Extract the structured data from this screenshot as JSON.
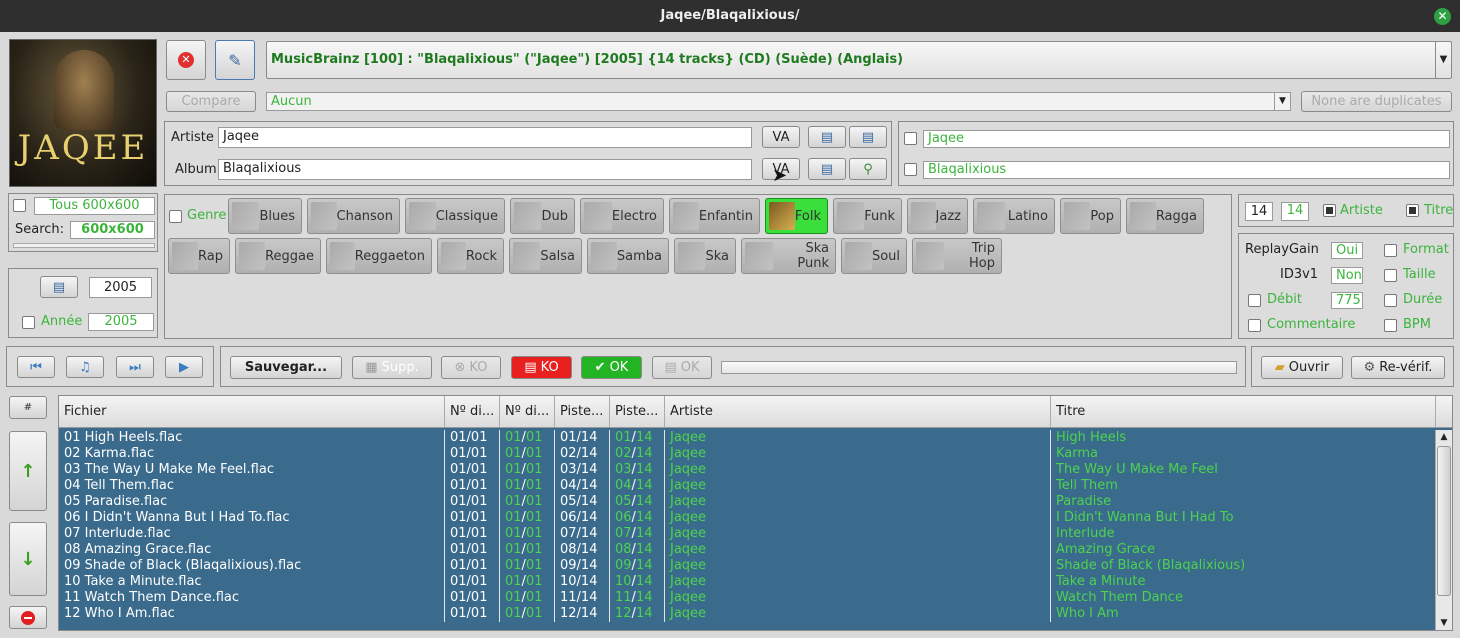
{
  "window": {
    "title": "Jaqee/Blaqalixious/"
  },
  "cover": {
    "artist_text": "JAQEE"
  },
  "cover_panel": {
    "label": "Tous 600x600",
    "search_label": "Search:",
    "search_value": "600x600"
  },
  "year_panel": {
    "year": "2005",
    "annee_label": "Année",
    "annee_value": "2005"
  },
  "musicbrainz": {
    "result": "MusicBrainz [100] : \"Blaqalixious\" (\"Jaqee\") [2005] {14 tracks} (CD) (Suède) (Anglais)"
  },
  "compare": {
    "label": "Compare",
    "select_value": "Aucun",
    "duplicates_label": "None are duplicates"
  },
  "tags": {
    "artiste_label": "Artiste",
    "artiste_value": "Jaqee",
    "album_label": "Album",
    "album_value": "Blaqalixious",
    "va_label": "VA"
  },
  "right_tags": {
    "artist": "Jaqee",
    "album": "Blaqalixious"
  },
  "genre": {
    "label": "Genre",
    "items": [
      "Blues",
      "Chanson",
      "Classique",
      "Dub",
      "Electro",
      "Enfantin",
      "Folk",
      "Funk",
      "Jazz",
      "Latino",
      "Pop",
      "Ragga",
      "Rap",
      "Reggae",
      "Reggaeton",
      "Rock",
      "Salsa",
      "Samba",
      "Ska",
      "Ska Punk",
      "Soul",
      "Trip Hop"
    ],
    "active": "Folk"
  },
  "track_counts": {
    "total": "14",
    "total_green": "14",
    "artiste_label": "Artiste",
    "titre_label": "Titre"
  },
  "options": {
    "replaygain_label": "ReplayGain",
    "replaygain_value": "Oui",
    "id3_label": "ID3v1",
    "id3_value": "Non",
    "debit_label": "Débit",
    "debit_value": "775",
    "commentaire_label": "Commentaire",
    "format_label": "Format",
    "taille_label": "Taille",
    "duree_label": "Durée",
    "bpm_label": "BPM"
  },
  "actions": {
    "save_label": "Sauvegar...",
    "delete_label": "Supp.",
    "ko1_label": "KO",
    "ko2_label": "KO",
    "ok1_label": "OK",
    "ok2_label": "OK",
    "open_label": "Ouvrir",
    "recheck_label": "Re-vérif."
  },
  "table": {
    "columns": [
      "Fichier",
      "Nº di...",
      "Nº di...",
      "Piste...",
      "Piste...",
      "Artiste",
      "Titre"
    ],
    "rows": [
      {
        "file": "01 High Heels.flac",
        "d1": "01/01",
        "d2a": "01",
        "d2b": "01",
        "p1": "01/14",
        "p2a": "01",
        "p2b": "14",
        "artist": "Jaqee",
        "title": "High Heels"
      },
      {
        "file": "02 Karma.flac",
        "d1": "01/01",
        "d2a": "01",
        "d2b": "01",
        "p1": "02/14",
        "p2a": "02",
        "p2b": "14",
        "artist": "Jaqee",
        "title": "Karma"
      },
      {
        "file": "03 The Way U Make Me Feel.flac",
        "d1": "01/01",
        "d2a": "01",
        "d2b": "01",
        "p1": "03/14",
        "p2a": "03",
        "p2b": "14",
        "artist": "Jaqee",
        "title": "The Way U Make Me Feel"
      },
      {
        "file": "04 Tell Them.flac",
        "d1": "01/01",
        "d2a": "01",
        "d2b": "01",
        "p1": "04/14",
        "p2a": "04",
        "p2b": "14",
        "artist": "Jaqee",
        "title": "Tell Them"
      },
      {
        "file": "05 Paradise.flac",
        "d1": "01/01",
        "d2a": "01",
        "d2b": "01",
        "p1": "05/14",
        "p2a": "05",
        "p2b": "14",
        "artist": "Jaqee",
        "title": "Paradise"
      },
      {
        "file": "06 I Didn't Wanna But I Had To.flac",
        "d1": "01/01",
        "d2a": "01",
        "d2b": "01",
        "p1": "06/14",
        "p2a": "06",
        "p2b": "14",
        "artist": "Jaqee",
        "title": "I Didn't Wanna But I Had To"
      },
      {
        "file": "07 Interlude.flac",
        "d1": "01/01",
        "d2a": "01",
        "d2b": "01",
        "p1": "07/14",
        "p2a": "07",
        "p2b": "14",
        "artist": "Jaqee",
        "title": "Interlude"
      },
      {
        "file": "08 Amazing Grace.flac",
        "d1": "01/01",
        "d2a": "01",
        "d2b": "01",
        "p1": "08/14",
        "p2a": "08",
        "p2b": "14",
        "artist": "Jaqee",
        "title": "Amazing Grace"
      },
      {
        "file": "09 Shade of Black (Blaqalixious).flac",
        "d1": "01/01",
        "d2a": "01",
        "d2b": "01",
        "p1": "09/14",
        "p2a": "09",
        "p2b": "14",
        "artist": "Jaqee",
        "title": "Shade of Black (Blaqalixious)"
      },
      {
        "file": "10 Take a Minute.flac",
        "d1": "01/01",
        "d2a": "01",
        "d2b": "01",
        "p1": "10/14",
        "p2a": "10",
        "p2b": "14",
        "artist": "Jaqee",
        "title": "Take a Minute"
      },
      {
        "file": "11 Watch Them Dance.flac",
        "d1": "01/01",
        "d2a": "01",
        "d2b": "01",
        "p1": "11/14",
        "p2a": "11",
        "p2b": "14",
        "artist": "Jaqee",
        "title": "Watch Them Dance"
      },
      {
        "file": "12 Who I Am.flac",
        "d1": "01/01",
        "d2a": "01",
        "d2b": "01",
        "p1": "12/14",
        "p2a": "12",
        "p2b": "14",
        "artist": "Jaqee",
        "title": "Who I Am"
      }
    ]
  },
  "colors": {
    "selection": "#3a6a8c",
    "green_text": "#3cb43c",
    "ok_button": "#22b422",
    "ko_button": "#e82020",
    "active_genre": "#3bdf3b"
  }
}
